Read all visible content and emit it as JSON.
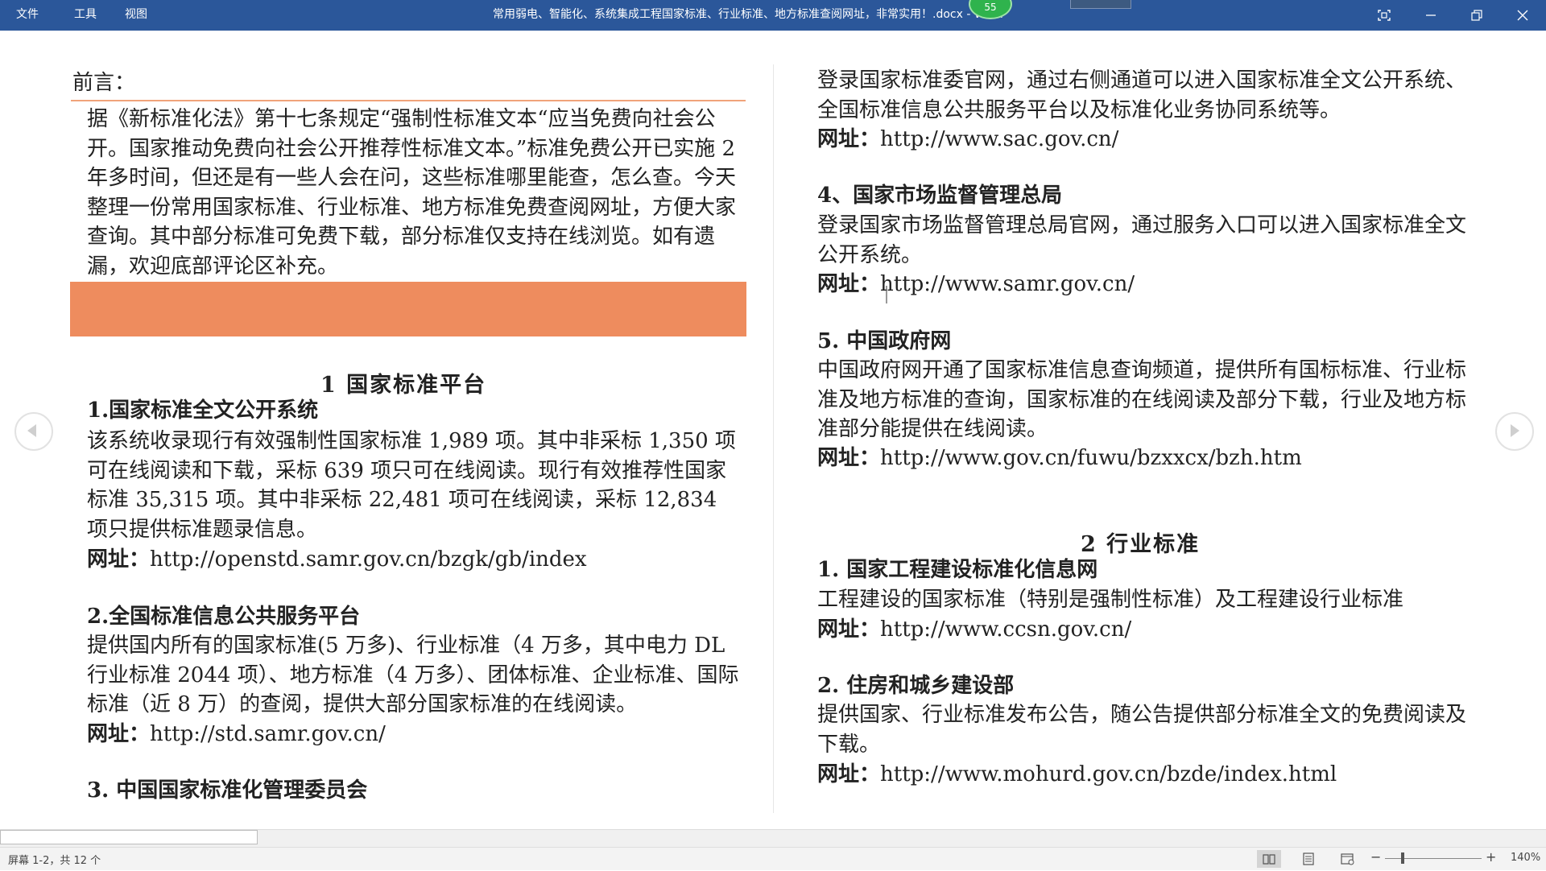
{
  "titlebar": {
    "menu": [
      "文件",
      "工具",
      "视图"
    ],
    "document_title": "常用弱电、智能化、系统集成工程国家标准、行业标准、地方标准查阅网址，非常实用！.docx  -  Word",
    "notification_count": "55"
  },
  "left": {
    "preface_title": "前言：",
    "preface_text": "据《新标准化法》第十七条规定“强制性标准文本“应当免费向社会公开。国家推动免费向社会公开推荐性标准文本。”标准免费公开已实施 2 年多时间，但还是有一些人会在问，这些标准哪里能查，怎么查。今天整理一份常用国家标准、行业标准、地方标准免费查阅网址，方便大家查询。其中部分标准可免费下载，部分标准仅支持在线浏览。如有遗漏，欢迎底部评论区补充。",
    "section1_title": "1 国家标准平台",
    "s1_item1_title": "1.国家标准全文公开系统",
    "s1_item1_text": "该系统收录现行有效强制性国家标准 1,989 项。其中非采标 1,350 项可在线阅读和下载，采标 639 项只可在线阅读。现行有效推荐性国家标准 35,315 项。其中非采标 22,481 项可在线阅读，采标 12,834 项只提供标准题录信息。",
    "s1_item1_url_label": "网址：",
    "s1_item1_url": "http://openstd.samr.gov.cn/bzgk/gb/index",
    "s1_item2_title": "2.全国标准信息公共服务平台",
    "s1_item2_text": "提供国内所有的国家标准(5 万多)、行业标准（4 万多，其中电力 DL 行业标准 2044 项）、地方标准（4 万多）、团体标准、企业标准、国际标准（近 8 万）的查阅，提供大部分国家标准的在线阅读。",
    "s1_item2_url_label": "网址：",
    "s1_item2_url": "http://std.samr.gov.cn/",
    "s1_item3_title": "3. 中国国家标准化管理委员会"
  },
  "right": {
    "s1_item3_text": "登录国家标准委官网，通过右侧通道可以进入国家标准全文公开系统、全国标准信息公共服务平台以及标准化业务协同系统等。",
    "s1_item3_url_label": "网址：",
    "s1_item3_url": "http://www.sac.gov.cn/",
    "s1_item4_title": "4、国家市场监督管理总局",
    "s1_item4_text": "登录国家市场监督管理总局官网，通过服务入口可以进入国家标准全文公开系统。",
    "s1_item4_url_label": "网址：",
    "s1_item4_url": "http://www.samr.gov.cn/",
    "s1_item5_title": "5. 中国政府网",
    "s1_item5_text": "中国政府网开通了国家标准信息查询频道，提供所有国标标准、行业标准及地方标准的查询，国家标准的在线阅读及部分下载，行业及地方标准部分能提供在线阅读。",
    "s1_item5_url_label": "网址：",
    "s1_item5_url": "http://www.gov.cn/fuwu/bzxxcx/bzh.htm",
    "section2_title": "2 行业标准",
    "s2_item1_title": "1. 国家工程建设标准化信息网",
    "s2_item1_text": "工程建设的国家标准（特别是强制性标准）及工程建设行业标准",
    "s2_item1_url_label": "网址：",
    "s2_item1_url": "http://www.ccsn.gov.cn/",
    "s2_item2_title": "2. 住房和城乡建设部",
    "s2_item2_text": "提供国家、行业标准发布公告，随公告提供部分标准全文的免费阅读及下载。",
    "s2_item2_url_label": "网址：",
    "s2_item2_url": "http://www.mohurd.gov.cn/bzde/index.html"
  },
  "statusbar": {
    "page_info": "屏幕 1-2，共 12 个",
    "zoom": "140%"
  },
  "colors": {
    "titlebar": "#2b579a",
    "orange_band": "#ee8c5e",
    "orange_rule": "#f0a37a",
    "notification": "#2fb34d"
  },
  "icons": [
    "focus-mode-icon",
    "minimize-icon",
    "restore-icon",
    "close-icon",
    "prev-screen-icon",
    "next-screen-icon",
    "read-mode-icon",
    "print-layout-icon",
    "web-layout-icon"
  ]
}
